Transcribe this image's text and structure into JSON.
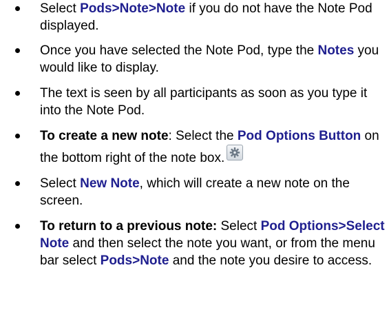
{
  "bullets": [
    {
      "parts": [
        "Select ",
        "Pods>Note>Note",
        " if you do not have the Note Pod displayed."
      ]
    },
    {
      "parts": [
        "Once you have selected the Note Pod, type the ",
        "Notes",
        " you would like to display."
      ]
    },
    {
      "parts": [
        "The text is seen by all participants as soon as you type it into the Note Pod."
      ]
    },
    {
      "parts": [
        "To create a new note",
        ":  Select the ",
        "Pod Options Button",
        " on the bottom right of the note box."
      ]
    },
    {
      "parts": [
        "Select ",
        "New Note",
        ", which will create a new note on the screen."
      ]
    },
    {
      "parts": [
        "To return to a previous note:",
        " Select ",
        "Pod Options>Select Note",
        " and then select the note you want, or from the menu bar select ",
        "Pods>Note",
        " and the note you desire to access."
      ]
    }
  ],
  "icons": {
    "pod_options": "gear-icon"
  },
  "colors": {
    "highlight": "#1f1f8f",
    "text": "#000000"
  }
}
